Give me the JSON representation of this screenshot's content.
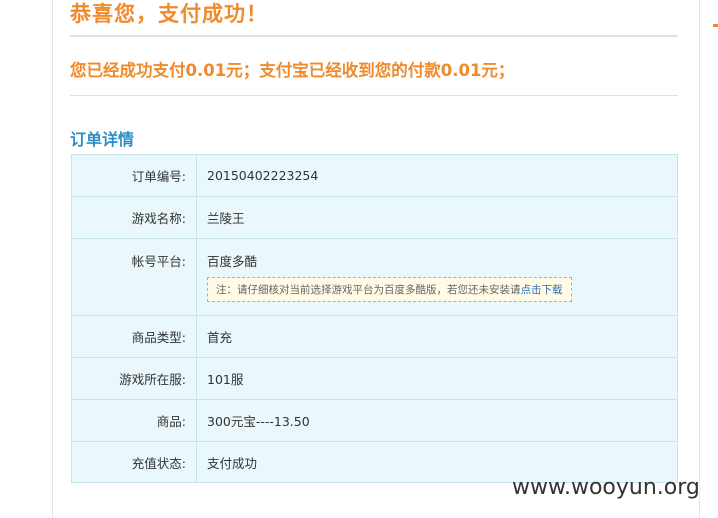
{
  "header": {
    "title": "恭喜您，支付成功！",
    "message": "您已经成功支付0.01元；支付宝已经收到您的付款0.01元；"
  },
  "order": {
    "section_title": "订单详情",
    "rows": [
      {
        "label": "订单编号:",
        "value": "20150402223254"
      },
      {
        "label": "游戏名称:",
        "value": "兰陵王"
      },
      {
        "label": "帐号平台:",
        "value": "百度多酷"
      },
      {
        "label": "商品类型:",
        "value": "首充"
      },
      {
        "label": "游戏所在服:",
        "value": "101服"
      },
      {
        "label": "商品:",
        "value": "300元宝----13.50"
      },
      {
        "label": "充值状态:",
        "value": "支付成功"
      }
    ],
    "platform_note": {
      "text": "注：请仔细核对当前选择游戏平台为百度多酷版，若您还未安装请",
      "link": "点击下载"
    }
  },
  "watermark": "www.wooyun.org",
  "colors": {
    "accent_orange": "#f08a2a",
    "section_blue": "#2e8fc6",
    "table_bg": "#eaf7fb",
    "table_border": "#c9e3ec",
    "note_border": "#f0a04b"
  }
}
